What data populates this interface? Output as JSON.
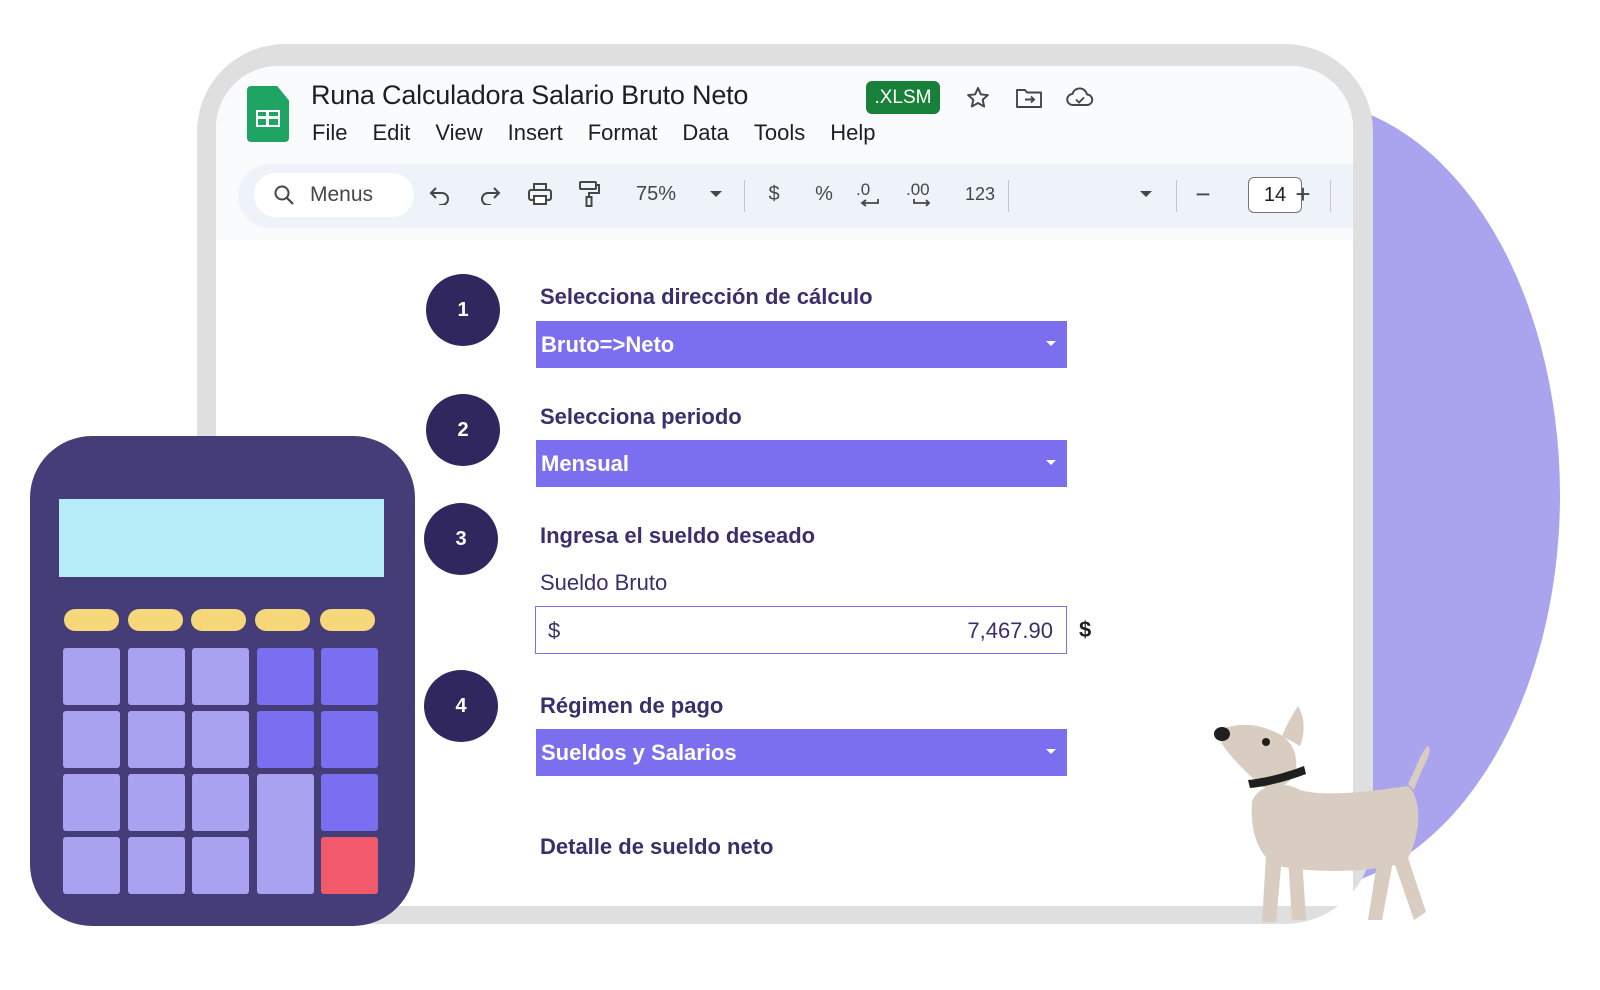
{
  "document": {
    "title": "Runa Calculadora Salario Bruto Neto",
    "badge": ".XLSM",
    "title_icons": [
      "star-icon",
      "move-to-folder-icon",
      "cloud-status-icon"
    ]
  },
  "menubar": {
    "items": [
      "File",
      "Edit",
      "View",
      "Insert",
      "Format",
      "Data",
      "Tools",
      "Help"
    ]
  },
  "toolbar": {
    "search_label": "Menus",
    "zoom": "75%",
    "currency": "$",
    "percent": "%",
    "decrease_decimal": ".0",
    "increase_decimal": ".00",
    "number_format": "123",
    "font_size": "14",
    "minus": "−",
    "plus": "+"
  },
  "form": {
    "steps": [
      {
        "number": "1",
        "label": "Selecciona dirección de cálculo",
        "value": "Bruto=>Neto"
      },
      {
        "number": "2",
        "label": "Selecciona periodo",
        "value": "Mensual"
      },
      {
        "number": "3",
        "label": "Ingresa el sueldo deseado",
        "sub_label": "Sueldo Bruto",
        "currency": "$",
        "value": "7,467.90",
        "suffix": "$"
      },
      {
        "number": "4",
        "label": "Régimen de pago",
        "value": "Sueldos y Salarios"
      }
    ],
    "section_heading": "Detalle de sueldo neto"
  },
  "colors": {
    "accent_purple": "#7b6ff0",
    "step_circle": "#31275f",
    "label_text": "#3b2f6b",
    "badge_green": "#188038",
    "decor_circle": "#aaa4ef",
    "calculator_body": "#443d78"
  }
}
